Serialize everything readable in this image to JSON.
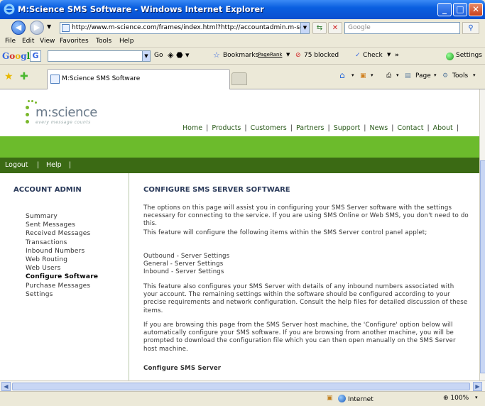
{
  "window": {
    "title": "M:Science SMS Software - Windows Internet Explorer"
  },
  "address_bar": {
    "url": "http://www.m-science.com/frames/index.html?http://accountadmin.m-scienc",
    "search_placeholder": "Google"
  },
  "menu": [
    "File",
    "Edit",
    "View",
    "Favorites",
    "Tools",
    "Help"
  ],
  "google_toolbar": {
    "logo": "Google",
    "go_label": "Go",
    "bookmarks_label": "Bookmarks",
    "pagerank_label": "PageRank",
    "blocked_label": "75 blocked",
    "check_label": "Check",
    "more_label": "»",
    "settings_label": "Settings"
  },
  "tab": {
    "label": "M:Science SMS Software"
  },
  "command_bar": {
    "page_label": "Page",
    "tools_label": "Tools"
  },
  "site": {
    "logo_text": "m:science",
    "logo_tagline": "every message counts",
    "nav": [
      "Home",
      "Products",
      "Customers",
      "Partners",
      "Support",
      "News",
      "Contact",
      "About"
    ],
    "account_links": [
      "Logout",
      "Help"
    ]
  },
  "sidebar": {
    "heading": "ACCOUNT ADMIN",
    "items": [
      {
        "label": "Summary",
        "active": false
      },
      {
        "label": "Sent Messages",
        "active": false
      },
      {
        "label": "Received Messages",
        "active": false
      },
      {
        "label": "Transactions",
        "active": false
      },
      {
        "label": "Inbound Numbers",
        "active": false
      },
      {
        "label": "Web Routing",
        "active": false
      },
      {
        "label": "Web Users",
        "active": false
      },
      {
        "label": "Configure Software",
        "active": true
      },
      {
        "label": "Purchase Messages",
        "active": false
      },
      {
        "label": "Settings",
        "active": false
      }
    ]
  },
  "content": {
    "title": "CONFIGURE SMS SERVER SOFTWARE",
    "para1": "The options on this page will assist you in configuring your SMS Server software with the settings necessary for connecting to the service. If you are using SMS Online or Web SMS, you don't need to do this.",
    "para2": "This feature will configure the following items within the SMS Server control panel applet;",
    "list": [
      "Outbound - Server Settings",
      "General - Server Settings",
      "Inbound - Server Settings"
    ],
    "para3": "This feature also configures your SMS Server with details of any inbound numbers associated with your account. The remaining settings within the software should be configured according to your precise requirements and network configuration. Consult the help files for detailed discussion of these items.",
    "para4": "If you are browsing this page from the SMS Server host machine, the 'Configure' option below will automatically configure your SMS software. If you are browsing from another machine, you will be prompted to download the configuration file which you can then open manually on the SMS Server host machine.",
    "subheading": "Configure SMS Server"
  },
  "status_bar": {
    "zone": "Internet",
    "zoom": "100%"
  }
}
